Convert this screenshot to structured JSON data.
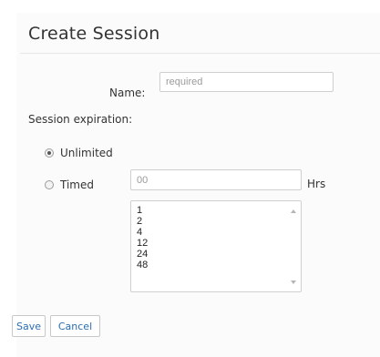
{
  "dialog": {
    "title": "Create Session"
  },
  "name_field": {
    "label": "Name:",
    "value": "",
    "placeholder": "required"
  },
  "expiration": {
    "label": "Session expiration:",
    "options": [
      {
        "label": "Unlimited",
        "checked": true
      },
      {
        "label": "Timed",
        "checked": false
      }
    ],
    "hours_value": "",
    "hours_placeholder": "00",
    "hours_unit": "Hrs",
    "hours_list": [
      "1",
      "2",
      "4",
      "12",
      "24",
      "48"
    ]
  },
  "buttons": {
    "save_label": "Save",
    "cancel_label": "Cancel"
  },
  "icons": {
    "scroll_up": "chevron-up-icon",
    "scroll_down": "chevron-down-icon"
  }
}
